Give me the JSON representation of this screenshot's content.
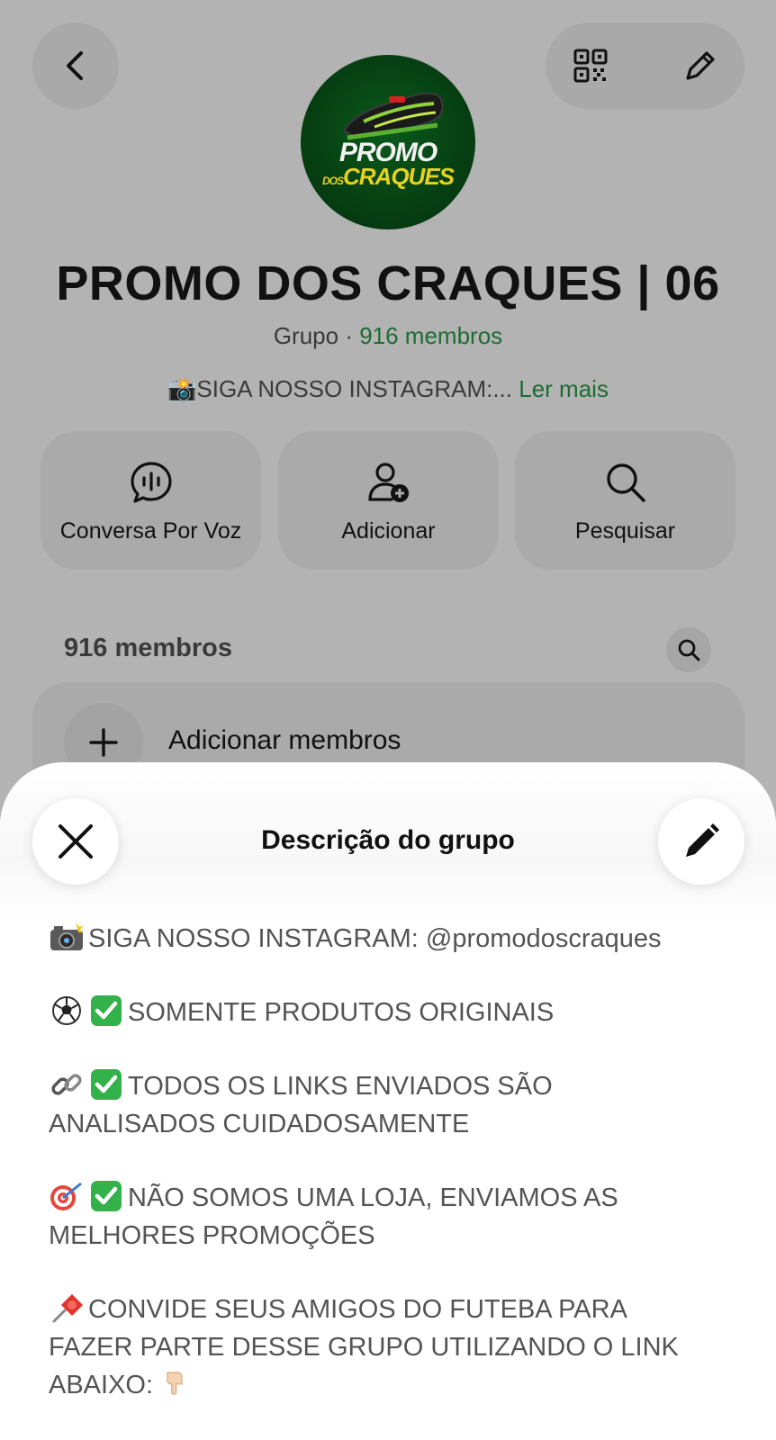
{
  "header": {
    "group_name": "PROMO DOS CRAQUES | 06",
    "group_type": "Grupo",
    "separator": " · ",
    "members_link": "916 membros",
    "description_preview": "📸SIGA NOSSO INSTAGRAM:...",
    "read_more": "Ler mais"
  },
  "avatar": {
    "line1": "PROMO",
    "line2_small": "DOS",
    "line2": "CRAQUES"
  },
  "actions": [
    {
      "label": "Conversa Por Voz",
      "icon": "voice-chat-icon"
    },
    {
      "label": "Adicionar",
      "icon": "add-person-icon"
    },
    {
      "label": "Pesquisar",
      "icon": "search-icon"
    }
  ],
  "members": {
    "count_label": "916 membros",
    "add_label": "Adicionar membros"
  },
  "sheet": {
    "title": "Descrição do grupo",
    "lines": [
      {
        "emoji": "camera-flash",
        "text": "SIGA NOSSO INSTAGRAM: @promodoscraques"
      },
      {
        "emoji": "soccer-ball+check",
        "text": "SOMENTE PRODUTOS ORIGINAIS"
      },
      {
        "emoji": "link+check",
        "text": "TODOS OS LINKS ENVIADOS SÃO",
        "text2": "ANALISADOS CUIDADOSAMENTE"
      },
      {
        "emoji": "target+check",
        "text": "NÃO SOMOS UMA LOJA, ENVIAMOS AS",
        "text2": "MELHORES PROMOÇÕES"
      },
      {
        "emoji": "pushpin",
        "text": "CONVIDE SEUS AMIGOS DO FUTEBA PARA",
        "text2": "FAZER PARTE DESSE GRUPO UTILIZANDO O LINK",
        "text3": "ABAIXO:",
        "trailing_emoji": "pointing-down-hand"
      }
    ]
  },
  "colors": {
    "accent_green": "#1e6b33",
    "dim_background": "#b3b3b3",
    "check_green": "#33b14a"
  }
}
